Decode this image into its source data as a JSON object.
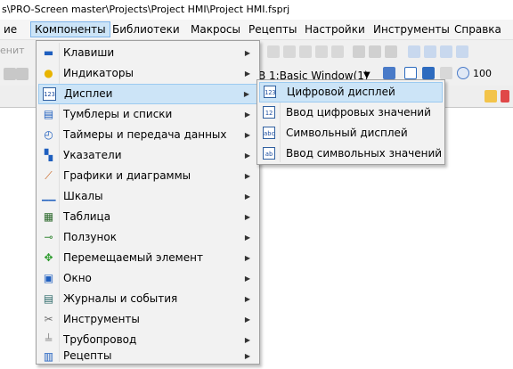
{
  "window": {
    "title": "s\\PRO-Screen master\\Projects\\Project HMI\\Project HMI.fsprj"
  },
  "menubar": {
    "items": [
      {
        "label": "ие"
      },
      {
        "label": "Компоненты"
      },
      {
        "label": "Библиотеки"
      },
      {
        "label": "Макросы"
      },
      {
        "label": "Рецепты"
      },
      {
        "label": "Настройки"
      },
      {
        "label": "Инструменты"
      },
      {
        "label": "Справка"
      }
    ]
  },
  "toolbar": {
    "left_fragment": "енит",
    "window_selector": "B 1:Basic Window(1)",
    "zoom_fragment": "100"
  },
  "components_menu": {
    "items": [
      {
        "label": "Клавиши",
        "icon": "keys-icon"
      },
      {
        "label": "Индикаторы",
        "icon": "bulb-icon"
      },
      {
        "label": "Дисплеи",
        "icon": "display-123-icon"
      },
      {
        "label": "Тумблеры и списки",
        "icon": "switch-list-icon"
      },
      {
        "label": "Таймеры и передача данных",
        "icon": "timer-icon"
      },
      {
        "label": "Указатели",
        "icon": "pointer-icon"
      },
      {
        "label": "Графики и диаграммы",
        "icon": "chart-icon"
      },
      {
        "label": "Шкалы",
        "icon": "scale-icon"
      },
      {
        "label": "Таблица",
        "icon": "table-icon"
      },
      {
        "label": "Ползунок",
        "icon": "slider-icon"
      },
      {
        "label": "Перемещаемый элемент",
        "icon": "move-icon"
      },
      {
        "label": "Окно",
        "icon": "window-icon"
      },
      {
        "label": "Журналы и события",
        "icon": "log-icon"
      },
      {
        "label": "Инструменты",
        "icon": "tools-icon"
      },
      {
        "label": "Трубопровод",
        "icon": "pipe-icon"
      },
      {
        "label": "Рецепты",
        "icon": "recipe-icon"
      }
    ]
  },
  "displays_submenu": {
    "items": [
      {
        "label": "Цифровой дисплей",
        "icon_text": "123"
      },
      {
        "label": "Ввод цифровых значений",
        "icon_text": "12"
      },
      {
        "label": "Символьный дисплей",
        "icon_text": "abc"
      },
      {
        "label": "Ввод символьных значений",
        "icon_text": "ab"
      }
    ]
  },
  "colors": {
    "highlight": "#cce4f7",
    "highlight_border": "#9ccaf0"
  }
}
